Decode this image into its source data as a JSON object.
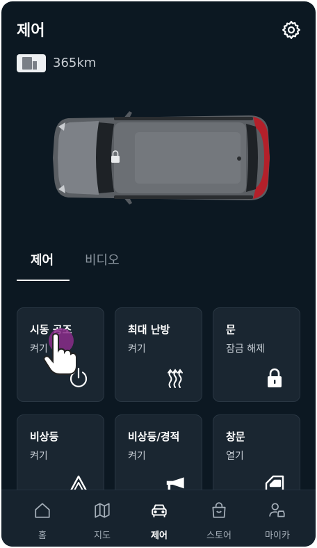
{
  "header": {
    "title": "제어",
    "settings_icon": "gear-icon"
  },
  "status": {
    "range": "365km",
    "battery_icon": "battery-icon"
  },
  "tabs": [
    {
      "label": "제어",
      "active": true
    },
    {
      "label": "비디오",
      "active": false
    }
  ],
  "controls": [
    {
      "title": "시동 공조",
      "subtitle": "켜기",
      "icon": "power-icon"
    },
    {
      "title": "최대 난방",
      "subtitle": "켜기",
      "icon": "heat-icon"
    },
    {
      "title": "문",
      "subtitle": "잠금 해제",
      "icon": "lock-icon"
    },
    {
      "title": "비상등",
      "subtitle": "켜기",
      "icon": "hazard-icon"
    },
    {
      "title": "비상등/경적",
      "subtitle": "켜기",
      "icon": "horn-icon"
    },
    {
      "title": "창문",
      "subtitle": "열기",
      "icon": "window-icon"
    }
  ],
  "bottom_nav": [
    {
      "label": "홈",
      "icon": "home-icon",
      "active": false
    },
    {
      "label": "지도",
      "icon": "map-icon",
      "active": false
    },
    {
      "label": "제어",
      "icon": "car-icon",
      "active": true
    },
    {
      "label": "스토어",
      "icon": "store-bag-icon",
      "active": false
    },
    {
      "label": "마이카",
      "icon": "my-car-profile-icon",
      "active": false
    }
  ],
  "colors": {
    "background": "#0c1822",
    "card": "#1a2631",
    "nav_bar": "#17232e",
    "accent_touch": "#8a2d8a"
  }
}
